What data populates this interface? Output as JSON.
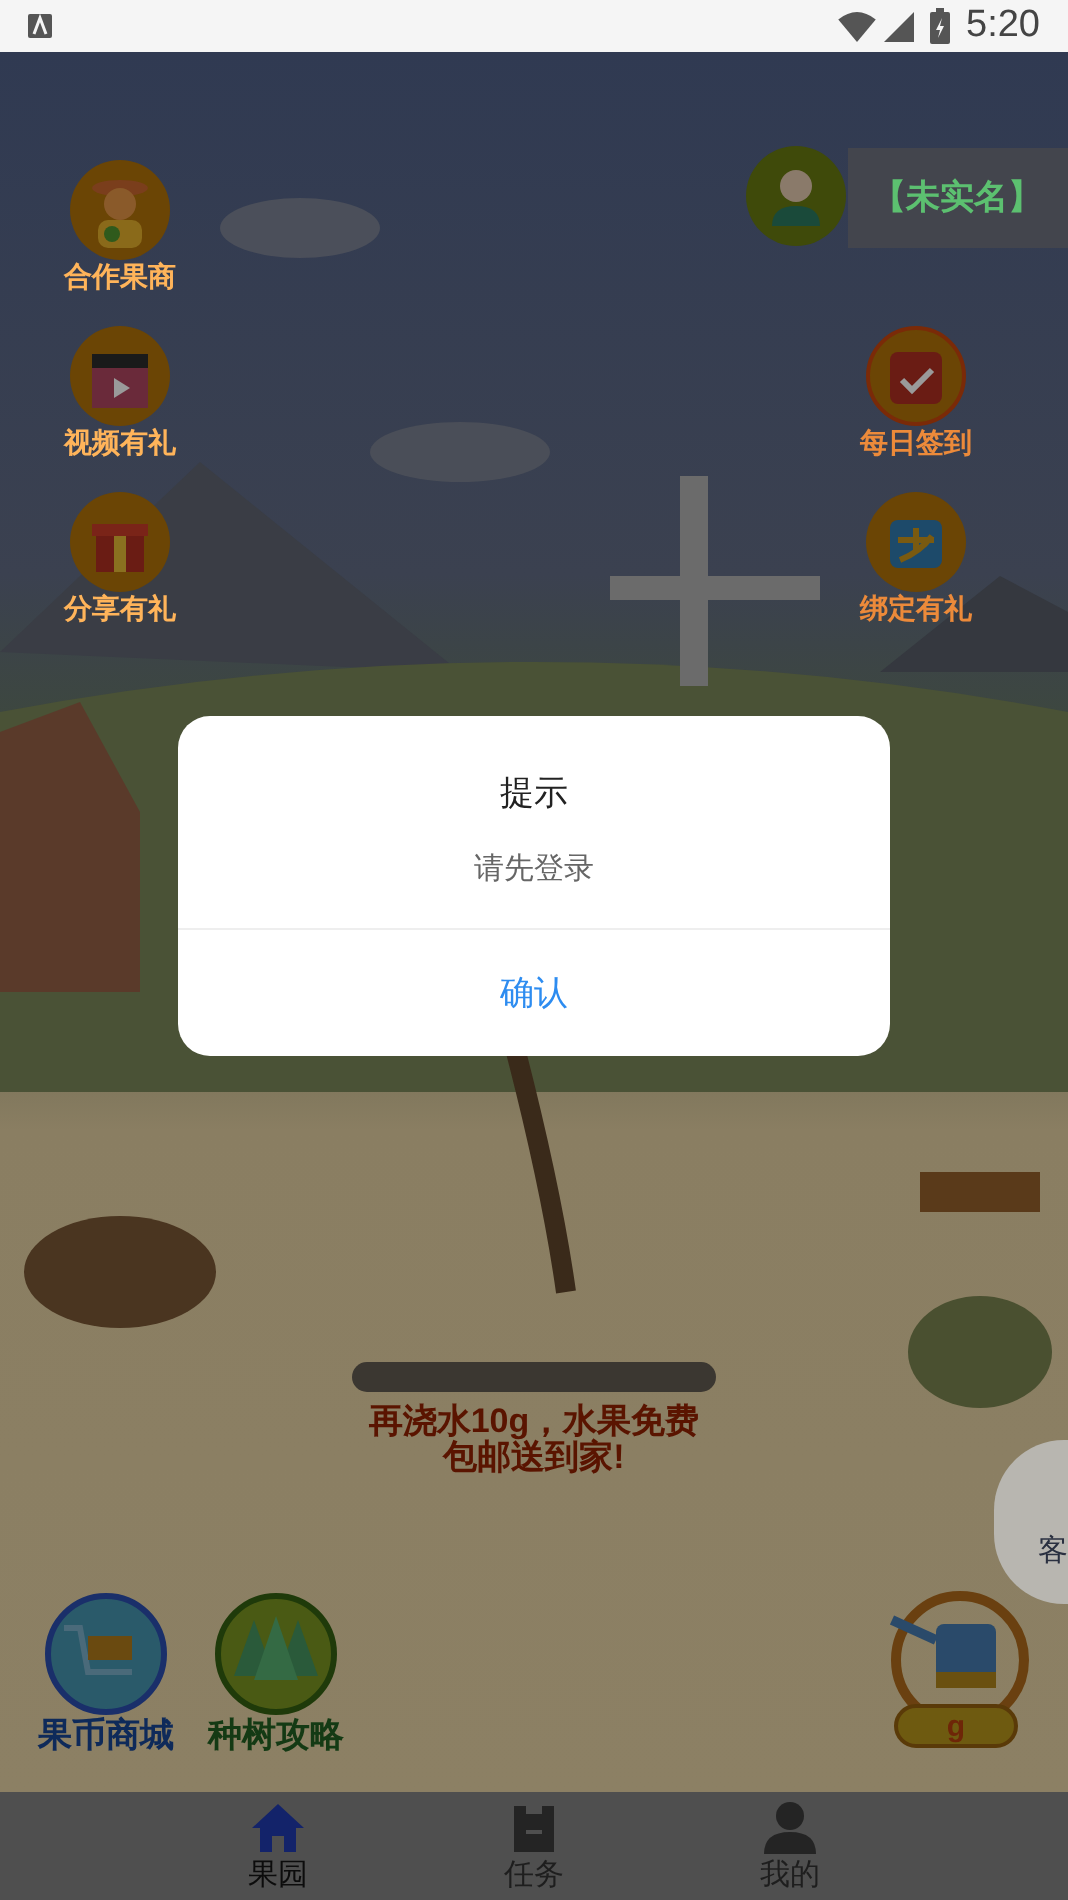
{
  "status_bar": {
    "time": "5:20"
  },
  "profile": {
    "name": "【未实名】"
  },
  "left_buttons": [
    {
      "label": "合作果商",
      "kind": "merchant"
    },
    {
      "label": "视频有礼",
      "kind": "video"
    },
    {
      "label": "分享有礼",
      "kind": "gift"
    }
  ],
  "right_buttons": [
    {
      "label": "每日签到",
      "kind": "calendar"
    },
    {
      "label": "绑定有礼",
      "kind": "pay"
    }
  ],
  "progress": {
    "level": 0,
    "message": "再浇水10g，水果免费包邮送到家!"
  },
  "bottom_buttons": [
    {
      "label": "果币商城",
      "kind": "cart"
    },
    {
      "label": "种树攻略",
      "kind": "trees"
    }
  ],
  "water": {
    "amount": "g"
  },
  "service": {
    "label": "客"
  },
  "dialog": {
    "title": "提示",
    "message": "请先登录",
    "confirm": "确认"
  },
  "tabs": [
    {
      "label": "果园",
      "kind": "home",
      "selected": true
    },
    {
      "label": "任务",
      "kind": "task",
      "selected": false
    },
    {
      "label": "我的",
      "kind": "user",
      "selected": false
    }
  ]
}
